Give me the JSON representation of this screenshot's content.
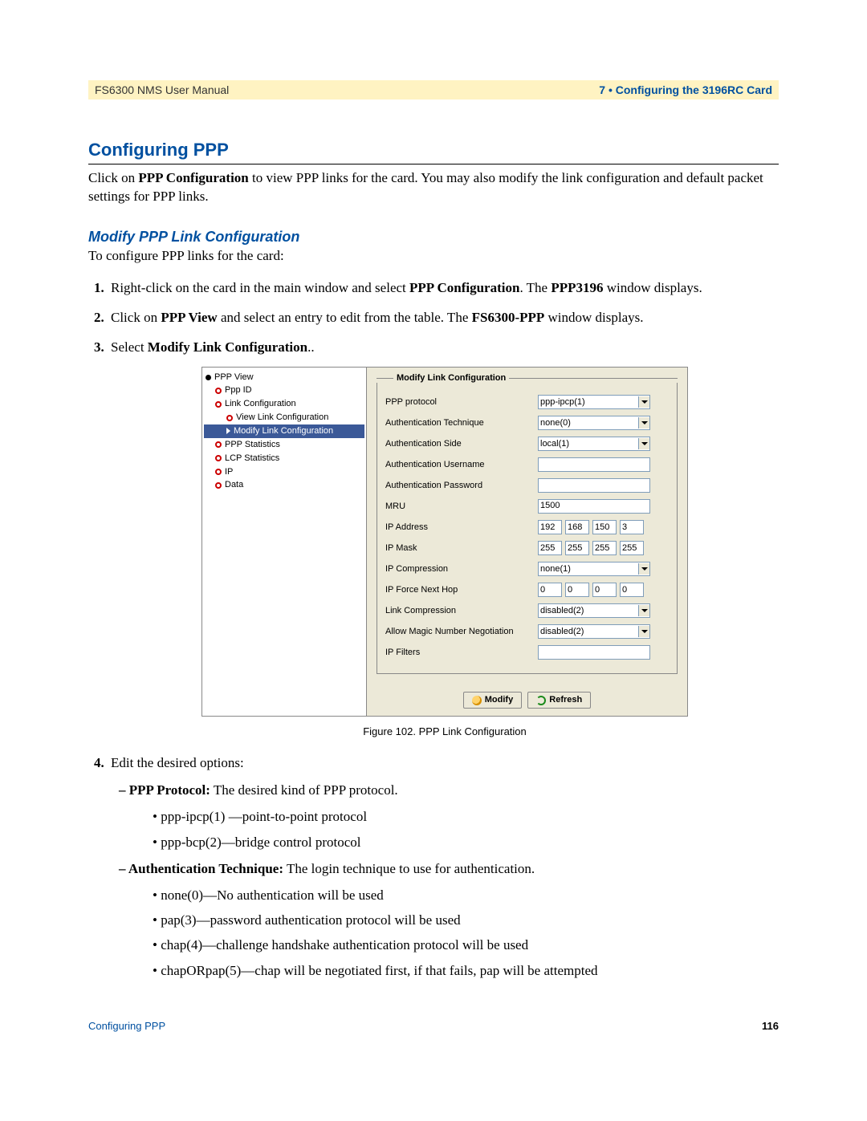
{
  "header": {
    "left": "FS6300 NMS User Manual",
    "right": "7 • Configuring the 3196RC Card"
  },
  "h1": "Configuring PPP",
  "intro_pre": "Click on ",
  "intro_bold": "PPP Configuration",
  "intro_post": " to view PPP links for the card. You may also modify the link configuration and default packet settings for PPP links.",
  "sub1": "Modify PPP Link Configuration",
  "sub1_intro": "To configure PPP links for the card:",
  "step1_pre": "Right-click on the card in the main window and select ",
  "step1_b1": "PPP Configuration",
  "step1_mid": ". The ",
  "step1_b2": "PPP3196",
  "step1_post": " window displays.",
  "step2_pre": "Click on ",
  "step2_b1": "PPP View",
  "step2_mid": " and select an entry to edit from the table. The ",
  "step2_b2": "FS6300-PPP",
  "step2_post": " window displays.",
  "step3_pre": "Select ",
  "step3_b1": "Modify Link Configuration",
  "step3_post": "..",
  "tree": {
    "root": "PPP View",
    "n1": "Ppp ID",
    "n2": "Link Configuration",
    "n2a": "View Link Configuration",
    "n2b": "Modify Link Configuration",
    "n3": "PPP Statistics",
    "n4": "LCP Statistics",
    "n5": "IP",
    "n6": "Data"
  },
  "form": {
    "group_title": "Modify Link Configuration",
    "rows": {
      "proto_lbl": "PPP protocol",
      "proto_val": "ppp-ipcp(1)",
      "auth_tech_lbl": "Authentication Technique",
      "auth_tech_val": "none(0)",
      "auth_side_lbl": "Authentication Side",
      "auth_side_val": "local(1)",
      "auth_user_lbl": "Authentication Username",
      "auth_user_val": "",
      "auth_pass_lbl": "Authentication Password",
      "auth_pass_val": "",
      "mru_lbl": "MRU",
      "mru_val": "1500",
      "ip_addr_lbl": "IP Address",
      "ip_a1": "192",
      "ip_a2": "168",
      "ip_a3": "150",
      "ip_a4": "3",
      "ip_mask_lbl": "IP Mask",
      "ip_m1": "255",
      "ip_m2": "255",
      "ip_m3": "255",
      "ip_m4": "255",
      "ip_comp_lbl": "IP Compression",
      "ip_comp_val": "none(1)",
      "ip_force_lbl": "IP Force Next Hop",
      "ip_f1": "0",
      "ip_f2": "0",
      "ip_f3": "0",
      "ip_f4": "0",
      "link_comp_lbl": "Link Compression",
      "link_comp_val": "disabled(2)",
      "magic_lbl": "Allow Magic Number Negotiation",
      "magic_val": "disabled(2)",
      "filters_lbl": "IP Filters",
      "filters_val": ""
    },
    "btn_modify": "Modify",
    "btn_refresh": "Refresh"
  },
  "figure_caption": "Figure 102. PPP Link Configuration",
  "step4_intro": "Edit the desired options:",
  "opt1_b": "PPP Protocol:",
  "opt1_t": " The desired kind of PPP protocol.",
  "opt1_li1": "ppp-ipcp(1) —point-to-point protocol",
  "opt1_li2": "ppp-bcp(2)—bridge control protocol",
  "opt2_b": "Authentication Technique:",
  "opt2_t": " The login technique to use for authentication.",
  "opt2_li1": "none(0)—No authentication will be used",
  "opt2_li2": "pap(3)—password authentication protocol will be used",
  "opt2_li3": "chap(4)—challenge handshake authentication protocol will be used",
  "opt2_li4": "chapORpap(5)—chap will be negotiated first, if that fails, pap will be attempted",
  "footer": {
    "left": "Configuring PPP",
    "right": "116"
  }
}
